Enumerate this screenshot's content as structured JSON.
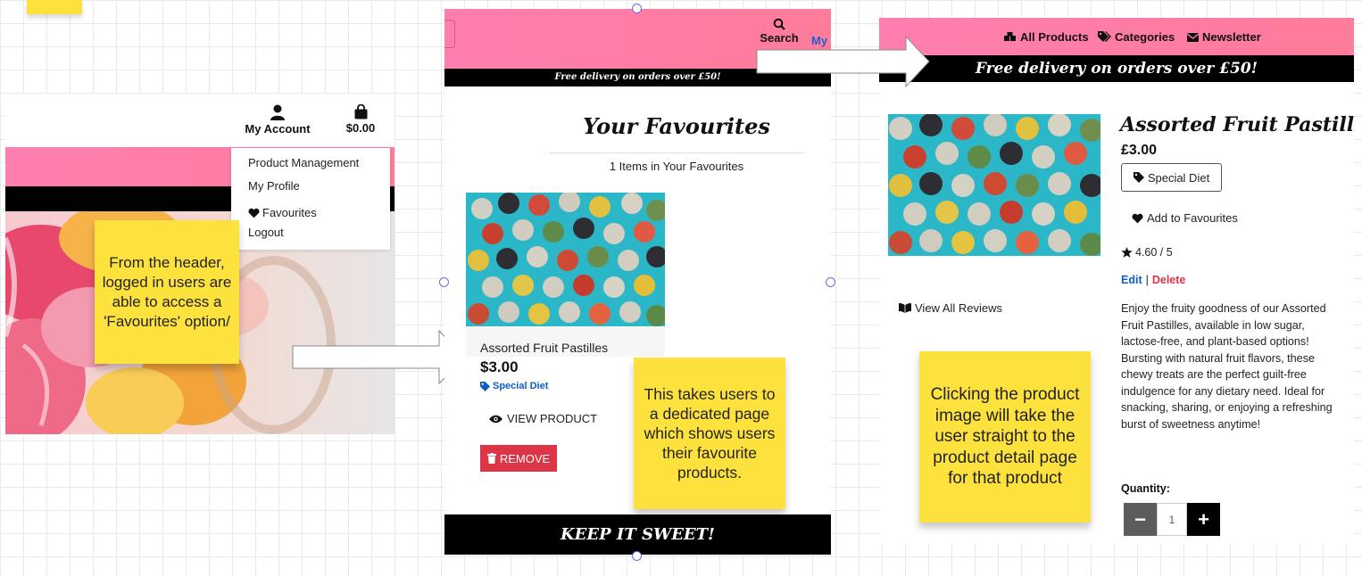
{
  "panel1": {
    "account_label": "My Account",
    "basket_total": "$0.00",
    "dropdown": [
      "Product Management",
      "My Profile",
      "Favourites",
      "Logout"
    ]
  },
  "panel2": {
    "search_label": "Search",
    "my_label": "My",
    "delivery_banner": "Free delivery on orders over £50!",
    "title": "Your Favourites",
    "count_text": "1 Items in Your Favourites",
    "product_name": "Assorted Fruit Pastilles",
    "price": "$3.00",
    "tag": "Special Diet",
    "view_button": "VIEW PRODUCT",
    "remove_button": "REMOVE",
    "footer": "KEEP IT SWEET!"
  },
  "panel3": {
    "nav": [
      "All Products",
      "Categories",
      "Newsletter"
    ],
    "delivery_banner": "Free delivery on orders over £50!",
    "product_title": "Assorted Fruit Pastilles",
    "price": "£3.00",
    "tag": "Special Diet",
    "favourite_button": "Add to Favourites",
    "rating": "4.60 / 5",
    "edit_link": "Edit",
    "separator": "|",
    "delete_link": "Delete",
    "reviews_link": "View All Reviews",
    "description": "Enjoy the fruity goodness of our Assorted Fruit Pastilles, available in low sugar, lactose-free, and plant-based options! Bursting with natural fruit flavors, these chewy treats are the perfect guilt-free indulgence for any dietary need. Ideal for snacking, sharing, or enjoying a refreshing burst of sweetness anytime!",
    "quantity_label": "Quantity:",
    "quantity_value": "1"
  },
  "notes": {
    "note1": "From the header, logged in users are able to access a 'Favourites' option/",
    "note2": "This takes users to a dedicated page which shows users their favourite products.",
    "note3": "Clicking the product image will take the user straight to the product detail page for that product"
  },
  "colors": {
    "brand_pink": "#ff7eb0",
    "banner_black": "#000000",
    "sticky_yellow": "#fde23e",
    "remove_red": "#dc3545",
    "link_blue": "#0d5fc7"
  }
}
